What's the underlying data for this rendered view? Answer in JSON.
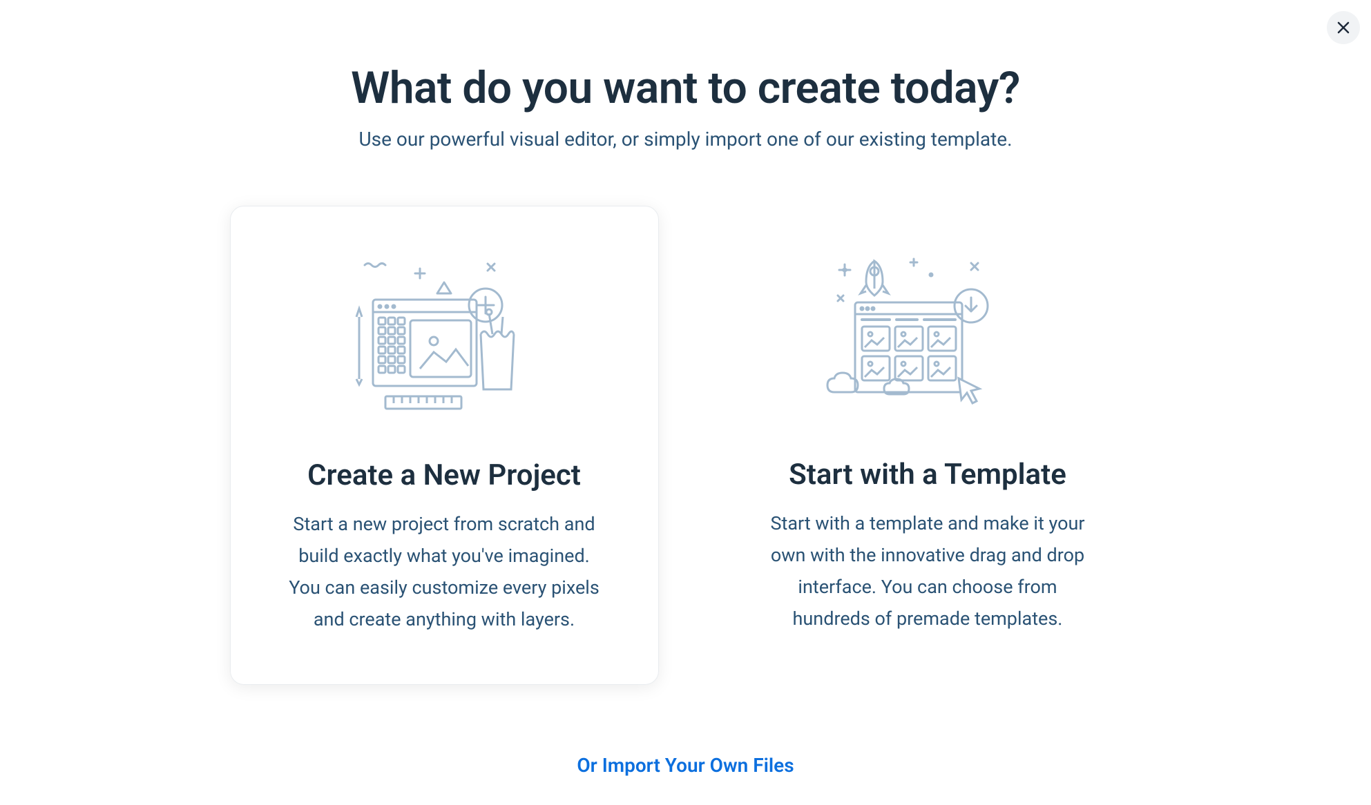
{
  "header": {
    "title": "What do you want to create today?",
    "subtitle": "Use our powerful visual editor, or simply import one of our existing template."
  },
  "options": {
    "create_new": {
      "title": "Create a New Project",
      "description": "Start a new project from scratch and build exactly what you've imagined. You can easily customize every pixels and create anything with layers."
    },
    "start_template": {
      "title": "Start with a Template",
      "description": "Start with a template and make it your own with the innovative drag and drop interface. You can choose from hundreds of premade templates."
    }
  },
  "import_link": {
    "label": "Or Import Your Own Files"
  },
  "colors": {
    "text_primary": "#1d2f3f",
    "text_secondary": "#2a5274",
    "link": "#0c6fde",
    "illustration": "#a3bacf"
  }
}
